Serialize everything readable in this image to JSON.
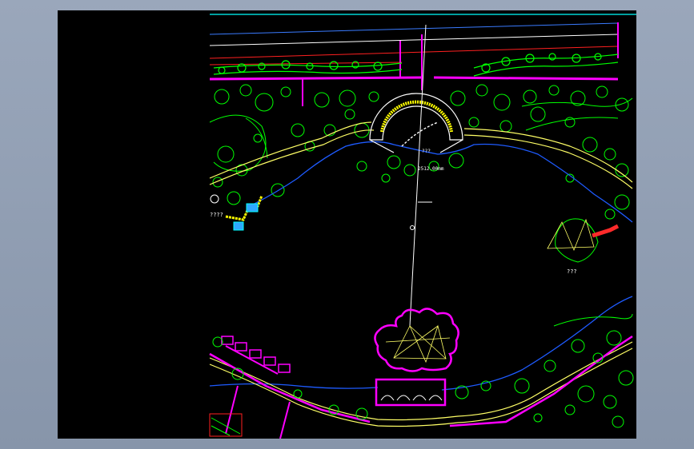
{
  "drawing": {
    "background": "#000000",
    "window_background": "#8f9cb1",
    "labels": {
      "west_area": "????",
      "east_island": "???",
      "pavilion_mark": "???",
      "bridge_text": "2512.00mm"
    },
    "colors": {
      "boundary": "#ff00ff",
      "vegetation": "#00ff00",
      "water_edge": "#1e5bff",
      "path": "#ffff66",
      "axis": "#ffffff",
      "road_red": "#ff2020",
      "road_cyan": "#00ffff",
      "bridge": "#ff2a2a",
      "platform": "#2fa8ff"
    }
  }
}
